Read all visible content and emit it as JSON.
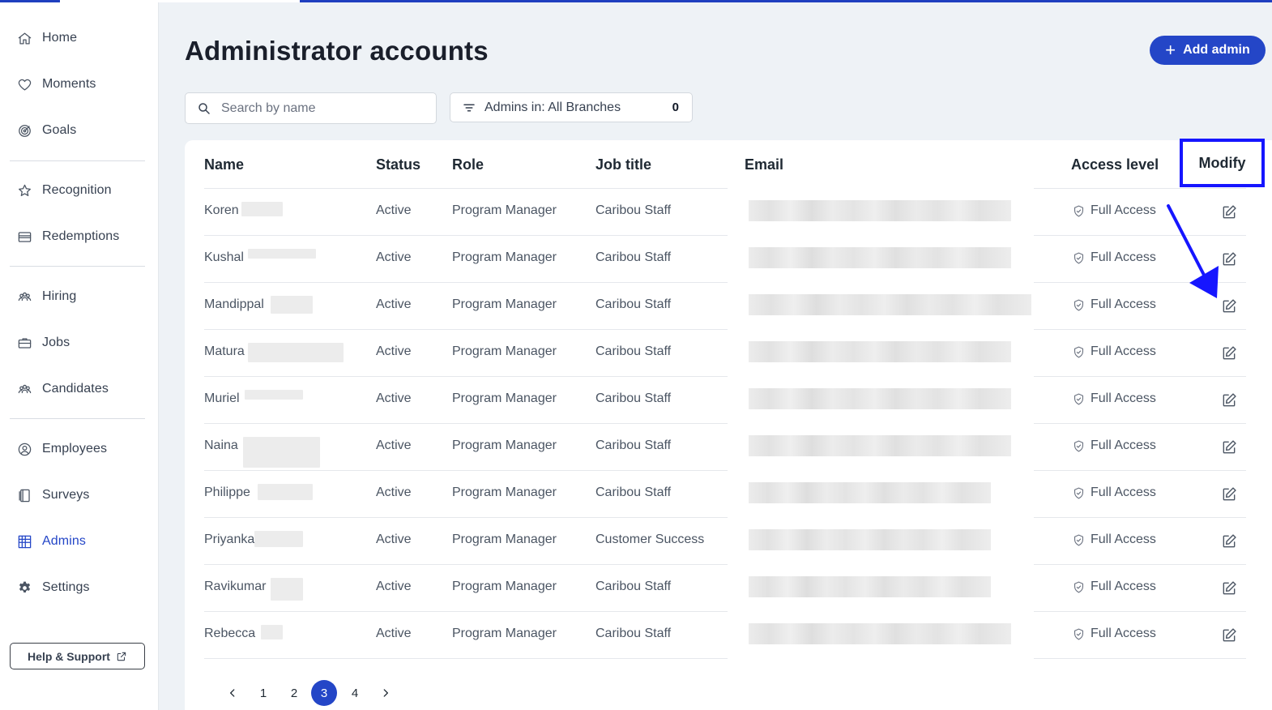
{
  "sidebar": {
    "items": [
      {
        "label": "Home",
        "icon": "home-icon"
      },
      {
        "label": "Moments",
        "icon": "heart-icon"
      },
      {
        "label": "Goals",
        "icon": "target-icon"
      },
      {
        "label": "Recognition",
        "icon": "star-icon"
      },
      {
        "label": "Redemptions",
        "icon": "card-icon"
      },
      {
        "label": "Hiring",
        "icon": "people-icon"
      },
      {
        "label": "Jobs",
        "icon": "briefcase-icon"
      },
      {
        "label": "Candidates",
        "icon": "people-icon"
      },
      {
        "label": "Employees",
        "icon": "user-circle-icon"
      },
      {
        "label": "Surveys",
        "icon": "clipboard-icon"
      },
      {
        "label": "Admins",
        "icon": "building-icon",
        "active": true
      },
      {
        "label": "Settings",
        "icon": "gear-icon"
      }
    ],
    "help_label": "Help & Support"
  },
  "header": {
    "title": "Administrator accounts",
    "add_button": "Add admin"
  },
  "search": {
    "placeholder": "Search by name"
  },
  "filter": {
    "label": "Admins in: All Branches",
    "count": "0"
  },
  "table": {
    "columns": {
      "name": "Name",
      "status": "Status",
      "role": "Role",
      "job_title": "Job title",
      "email": "Email",
      "access": "Access level",
      "modify": "Modify"
    },
    "rows": [
      {
        "name": "Koren",
        "status": "Active",
        "role": "Program Manager",
        "job_title": "Caribou Staff",
        "access": "Full Access"
      },
      {
        "name": "Kushal",
        "status": "Active",
        "role": "Program Manager",
        "job_title": "Caribou Staff",
        "access": "Full Access"
      },
      {
        "name": "Mandippal",
        "status": "Active",
        "role": "Program Manager",
        "job_title": "Caribou Staff",
        "access": "Full Access"
      },
      {
        "name": "Matura",
        "status": "Active",
        "role": "Program Manager",
        "job_title": "Caribou Staff",
        "access": "Full Access"
      },
      {
        "name": "Muriel",
        "status": "Active",
        "role": "Program Manager",
        "job_title": "Caribou Staff",
        "access": "Full Access"
      },
      {
        "name": "Naina",
        "status": "Active",
        "role": "Program Manager",
        "job_title": "Caribou Staff",
        "access": "Full Access"
      },
      {
        "name": "Philippe",
        "status": "Active",
        "role": "Program Manager",
        "job_title": "Caribou Staff",
        "access": "Full Access"
      },
      {
        "name": "Priyanka",
        "status": "Active",
        "role": "Program Manager",
        "job_title": "Customer Success",
        "access": "Full Access"
      },
      {
        "name": "Ravikumar",
        "status": "Active",
        "role": "Program Manager",
        "job_title": "Caribou Staff",
        "access": "Full Access"
      },
      {
        "name": "Rebecca",
        "status": "Active",
        "role": "Program Manager",
        "job_title": "Caribou Staff",
        "access": "Full Access"
      }
    ]
  },
  "pagination": {
    "pages": [
      "1",
      "2",
      "3",
      "4"
    ],
    "current": "3"
  },
  "colors": {
    "accent": "#2446c7",
    "highlight_box": "#1616ff",
    "page_background": "#eef2f6"
  }
}
